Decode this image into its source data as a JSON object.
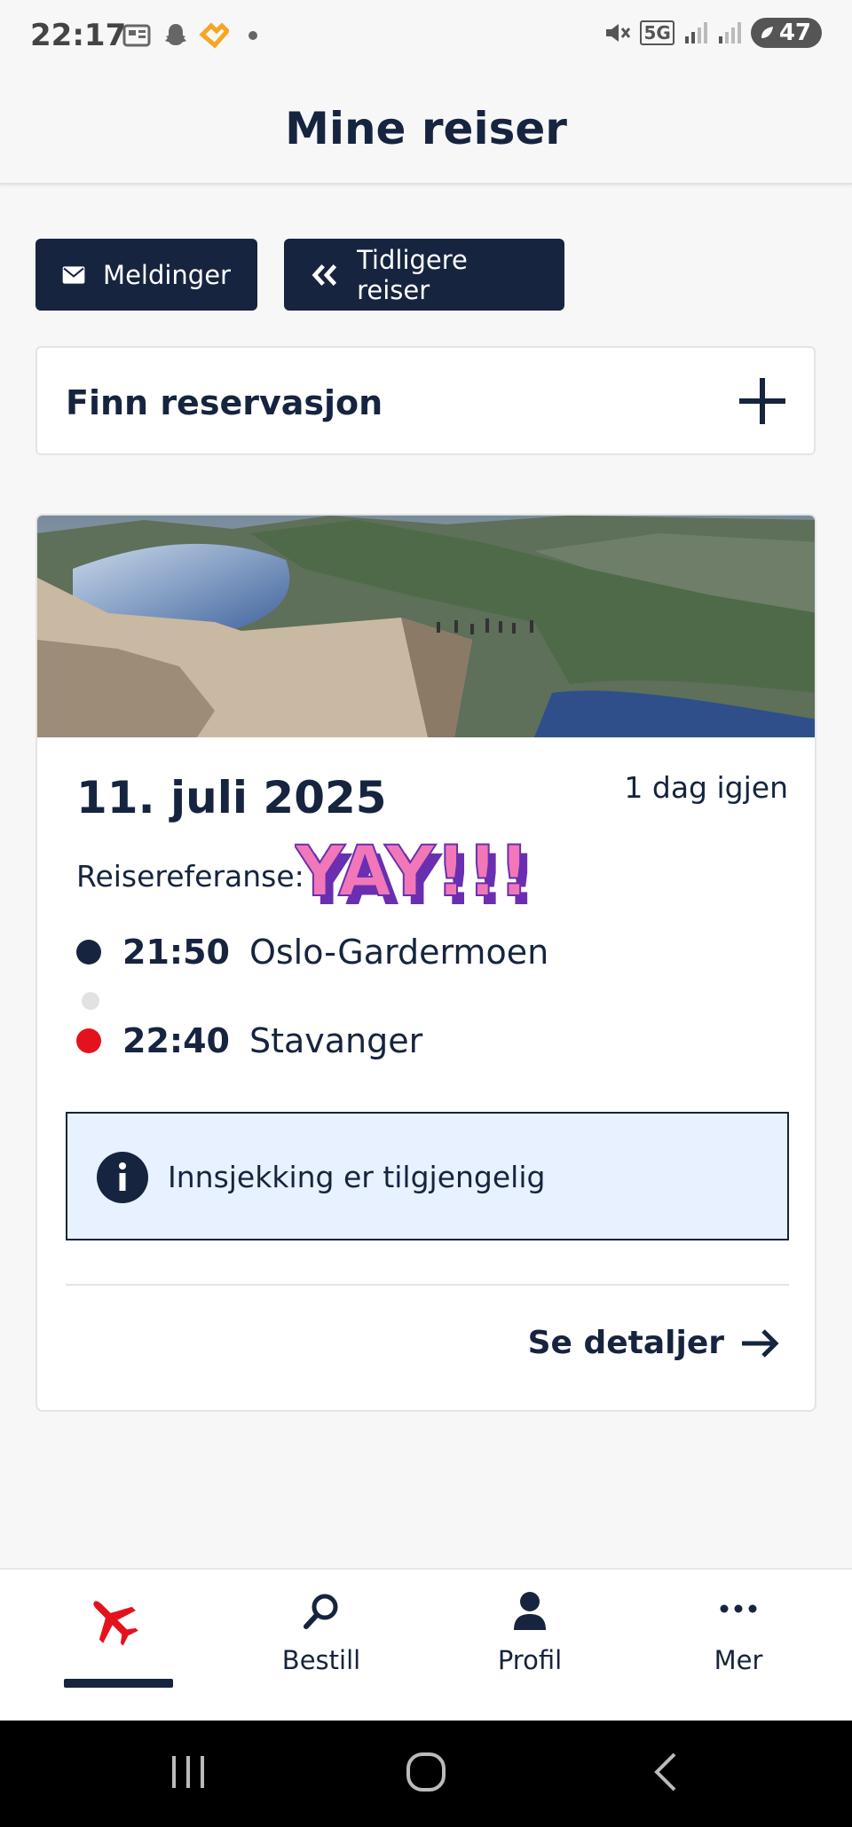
{
  "status_bar": {
    "time": "22:17",
    "battery": "47",
    "network": "5G"
  },
  "header": {
    "title": "Mine reiser"
  },
  "actions": {
    "messages_label": "Meldinger",
    "previous_trips_label": "Tidligere reiser"
  },
  "find_reservation": {
    "label": "Finn reservasjon"
  },
  "trip": {
    "date": "11. juli 2025",
    "days_left": "1 dag igjen",
    "reference_label": "Reisereferanse:",
    "sticker_text": "YAY!!!",
    "departure": {
      "time": "21:50",
      "place": "Oslo-Gardermoen"
    },
    "arrival": {
      "time": "22:40",
      "place": "Stavanger"
    },
    "checkin_notice": "Innsjekking er tilgjengelig",
    "details_label": "Se detaljer"
  },
  "tabs": [
    {
      "label": "",
      "icon": "plane-icon",
      "active": true
    },
    {
      "label": "Bestill",
      "icon": "search-icon",
      "active": false
    },
    {
      "label": "Profil",
      "icon": "person-icon",
      "active": false
    },
    {
      "label": "Mer",
      "icon": "more-icon",
      "active": false
    }
  ],
  "colors": {
    "navy": "#16243f",
    "red": "#e3131e",
    "info_bg": "#e8f1ff",
    "page_bg": "#f7f7f7"
  }
}
